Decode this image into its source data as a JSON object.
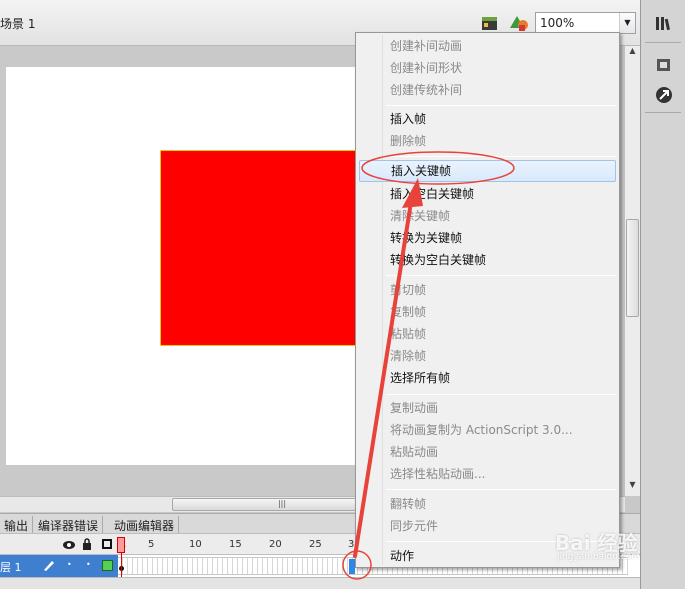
{
  "scene": {
    "label": "场景 1",
    "zoom": "100%"
  },
  "bottom_tabs": [
    "输出",
    "编译器错误",
    "动画编辑器"
  ],
  "timeline": {
    "frame_numbers": [
      "1",
      "5",
      "10",
      "15",
      "20",
      "25",
      "3"
    ],
    "layer_name": "层 1"
  },
  "context_menu": {
    "items": [
      {
        "label": "创建补间动画",
        "enabled": false
      },
      {
        "label": "创建补间形状",
        "enabled": false
      },
      {
        "label": "创建传统补间",
        "enabled": false
      },
      {
        "label": "插入帧",
        "enabled": true
      },
      {
        "label": "删除帧",
        "enabled": false
      },
      {
        "label": "插入关键帧",
        "enabled": true,
        "highlighted": true
      },
      {
        "label": "插入空白关键帧",
        "enabled": true
      },
      {
        "label": "清除关键帧",
        "enabled": false
      },
      {
        "label": "转换为关键帧",
        "enabled": true
      },
      {
        "label": "转换为空白关键帧",
        "enabled": true
      },
      {
        "label": "剪切帧",
        "enabled": false
      },
      {
        "label": "复制帧",
        "enabled": false
      },
      {
        "label": "粘贴帧",
        "enabled": false
      },
      {
        "label": "清除帧",
        "enabled": false
      },
      {
        "label": "选择所有帧",
        "enabled": true
      },
      {
        "label": "复制动画",
        "enabled": false
      },
      {
        "label": "将动画复制为 ActionScript 3.0...",
        "enabled": false
      },
      {
        "label": "粘贴动画",
        "enabled": false
      },
      {
        "label": "选择性粘贴动画...",
        "enabled": false
      },
      {
        "label": "翻转帧",
        "enabled": false
      },
      {
        "label": "同步元件",
        "enabled": false
      },
      {
        "label": "动作",
        "enabled": true
      }
    ]
  },
  "watermark": {
    "text": "Bai 经验",
    "sub": "jingyan.baidu.com"
  },
  "colors": {
    "shape_fill": "#ff0000",
    "annotation": "#e8433a",
    "selected_layer": "#3f7fd0"
  }
}
